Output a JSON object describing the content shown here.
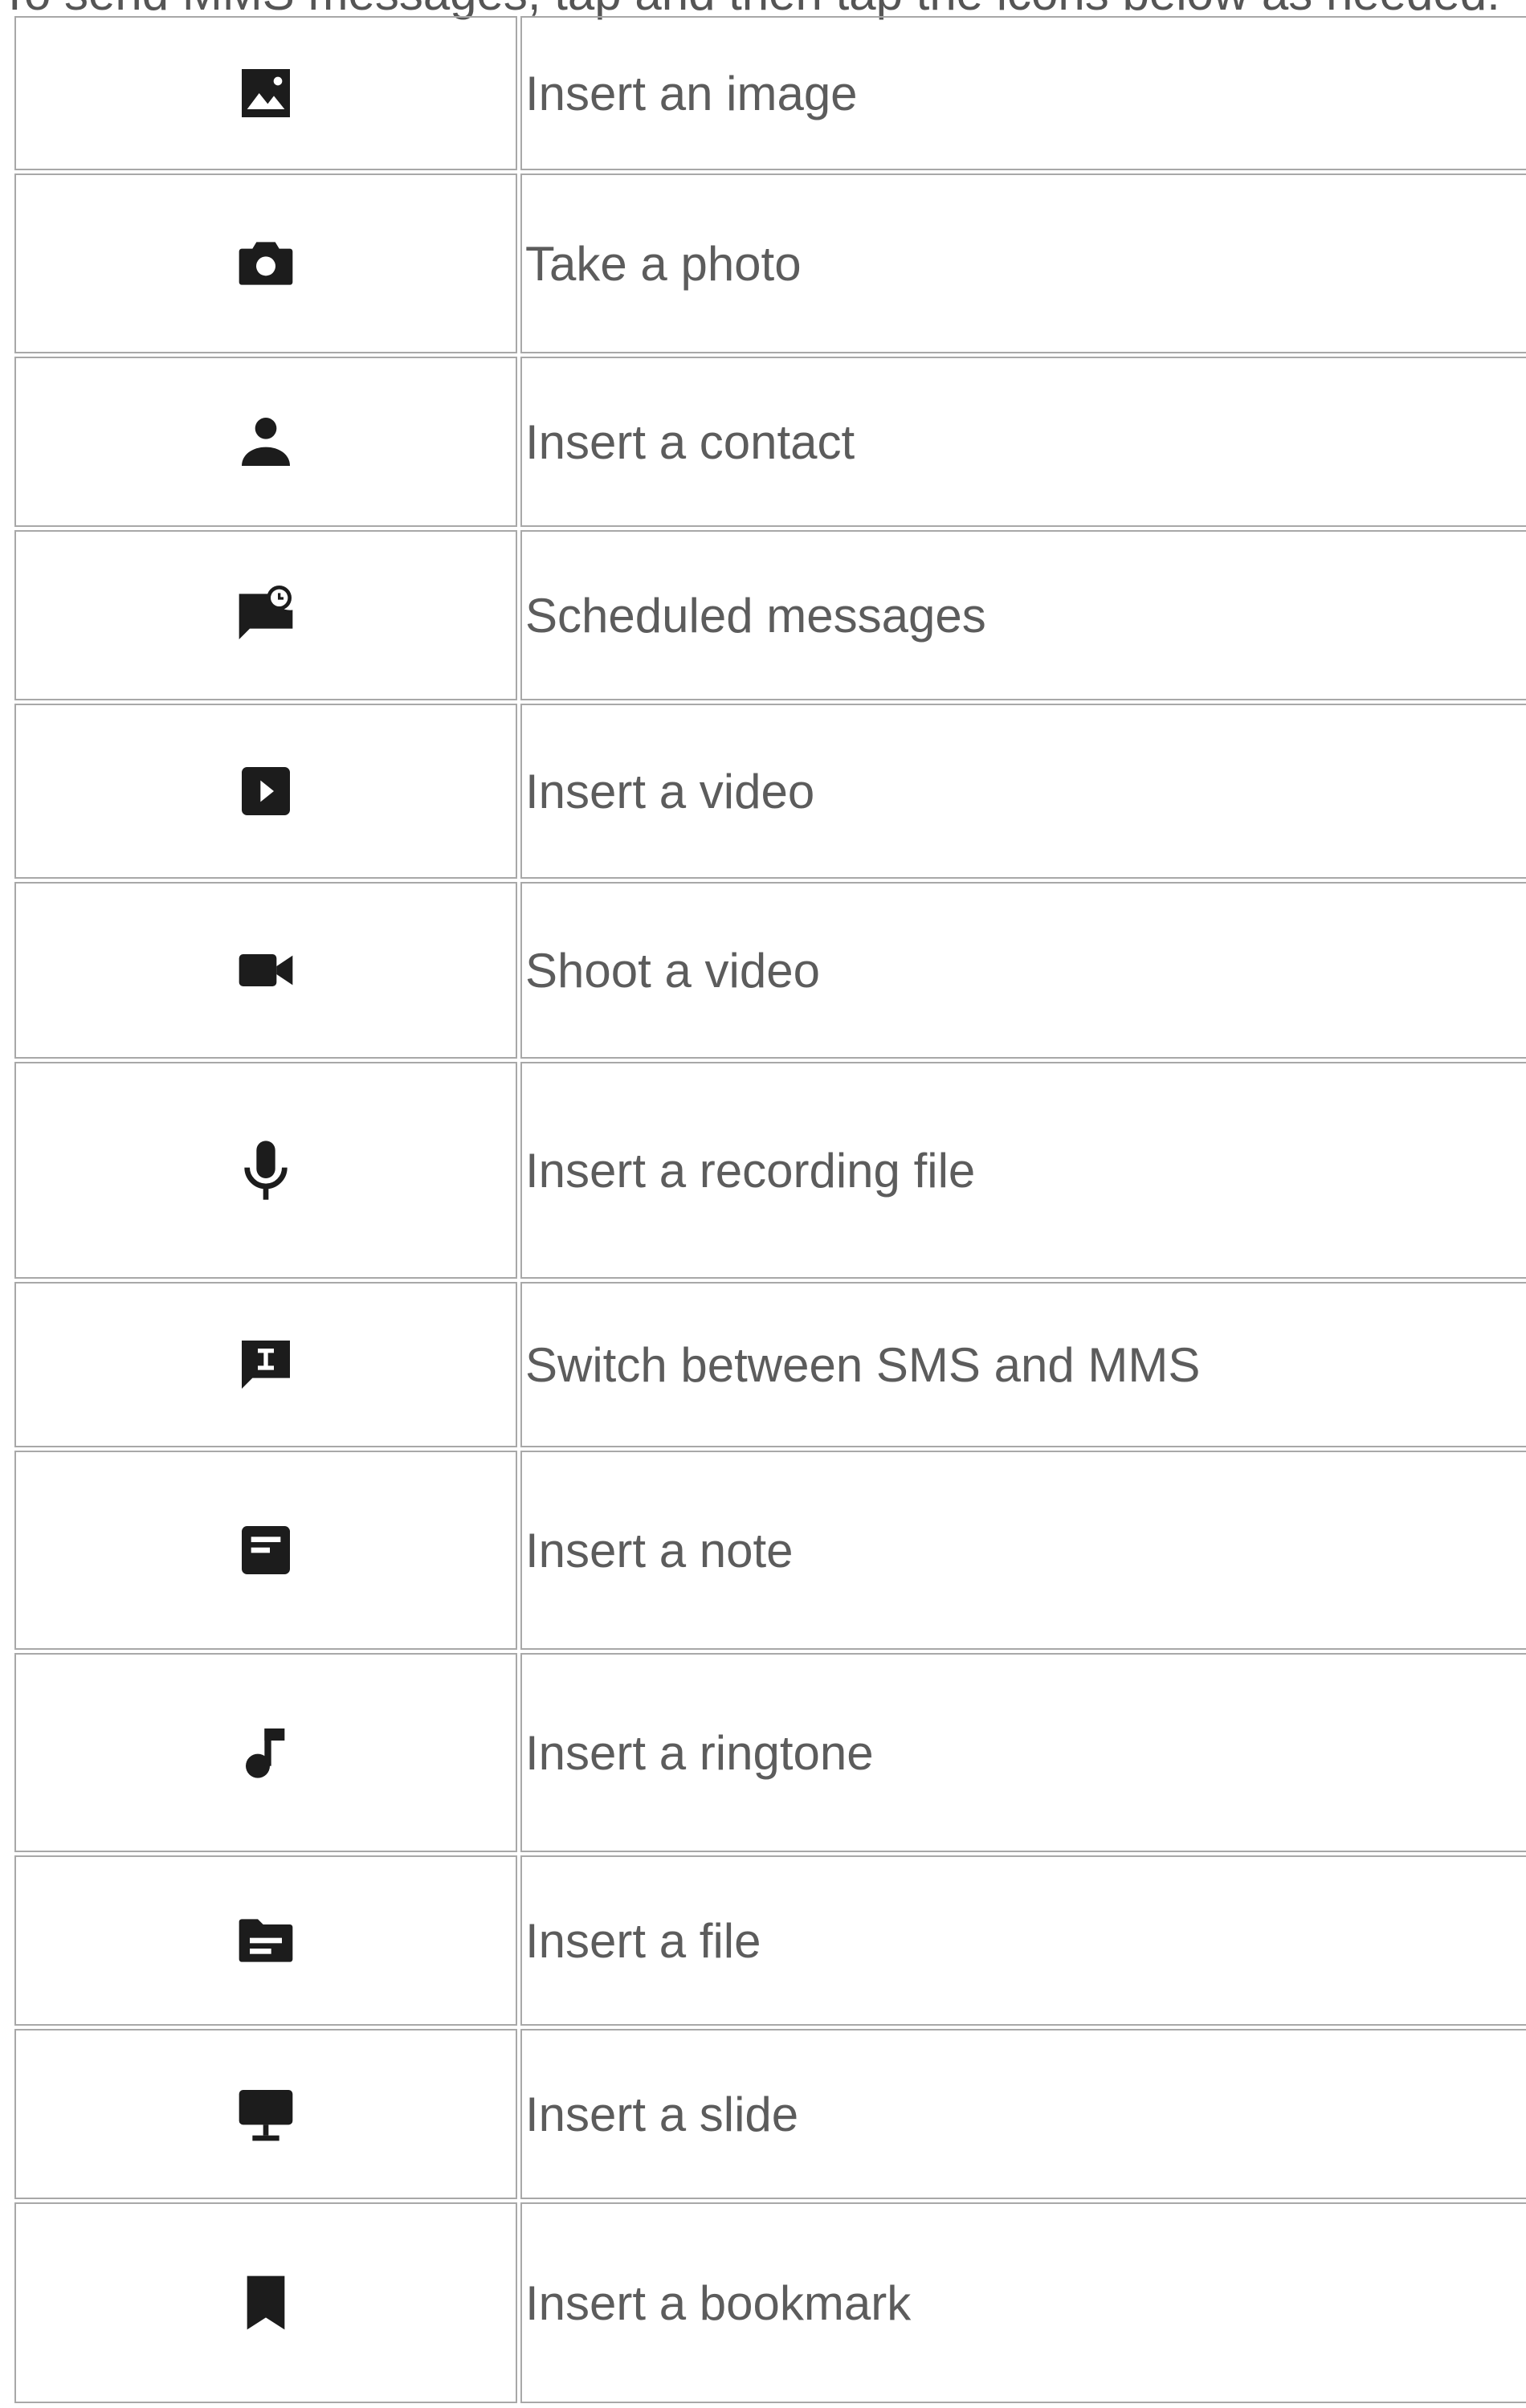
{
  "intro_fragment": "To send MMS messages, tap    and then tap the icons below as needed.",
  "rows": [
    {
      "icon": "image-icon",
      "label": "Insert an image"
    },
    {
      "icon": "camera-icon",
      "label": "Take a photo"
    },
    {
      "icon": "contact-icon",
      "label": "Insert a contact"
    },
    {
      "icon": "scheduled-message-icon",
      "label": "Scheduled messages"
    },
    {
      "icon": "video-play-icon",
      "label": "Insert a video"
    },
    {
      "icon": "video-camera-icon",
      "label": "Shoot a video"
    },
    {
      "icon": "microphone-icon",
      "label": "Insert a recording file"
    },
    {
      "icon": "sms-mms-switch-icon",
      "label": "Switch between SMS and MMS"
    },
    {
      "icon": "note-icon",
      "label": "Insert a note"
    },
    {
      "icon": "music-note-icon",
      "label": "Insert a ringtone"
    },
    {
      "icon": "folder-file-icon",
      "label": "Insert a file"
    },
    {
      "icon": "slide-presentation-icon",
      "label": "Insert a slide"
    },
    {
      "icon": "bookmark-icon",
      "label": "Insert a bookmark"
    }
  ]
}
